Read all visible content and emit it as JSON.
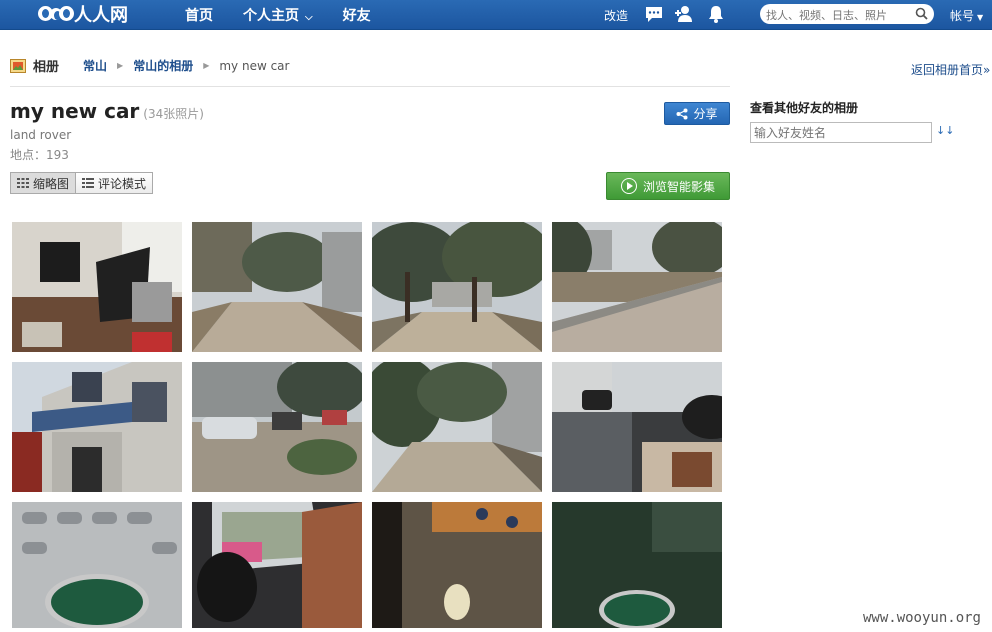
{
  "nav": {
    "logo": "人人网",
    "links": [
      "首页",
      "个人主页",
      "好友"
    ],
    "gaizao": "改造",
    "search_placeholder": "找人、视频、日志、照片",
    "account": "帐号"
  },
  "breadcrumb": {
    "root": "相册",
    "items": [
      "常山",
      "常山的相册"
    ],
    "current": "my new car"
  },
  "back_link": "返回相册首页»",
  "album": {
    "title": "my new car",
    "count": "(34张照片)",
    "description": "land rover",
    "location": "地点：193"
  },
  "buttons": {
    "share": "分享",
    "thumbnail": "缩略图",
    "comment_mode": "评论模式",
    "browse": "浏览智能影集"
  },
  "photos": [
    {
      "name": "photo-office-desk"
    },
    {
      "name": "photo-courtyard-road"
    },
    {
      "name": "photo-tree-lined-road"
    },
    {
      "name": "photo-parking-lot"
    },
    {
      "name": "photo-building-entrance"
    },
    {
      "name": "photo-parked-cars"
    },
    {
      "name": "photo-road-trees"
    },
    {
      "name": "photo-car-door-interior"
    },
    {
      "name": "photo-land-rover-grille"
    },
    {
      "name": "photo-car-seat"
    },
    {
      "name": "photo-floor-mat-3m"
    },
    {
      "name": "photo-land-rover-badge"
    }
  ],
  "sidebar": {
    "title": "查看其他好友的相册",
    "input_placeholder": "输入好友姓名"
  },
  "watermark": "www.wooyun.org"
}
